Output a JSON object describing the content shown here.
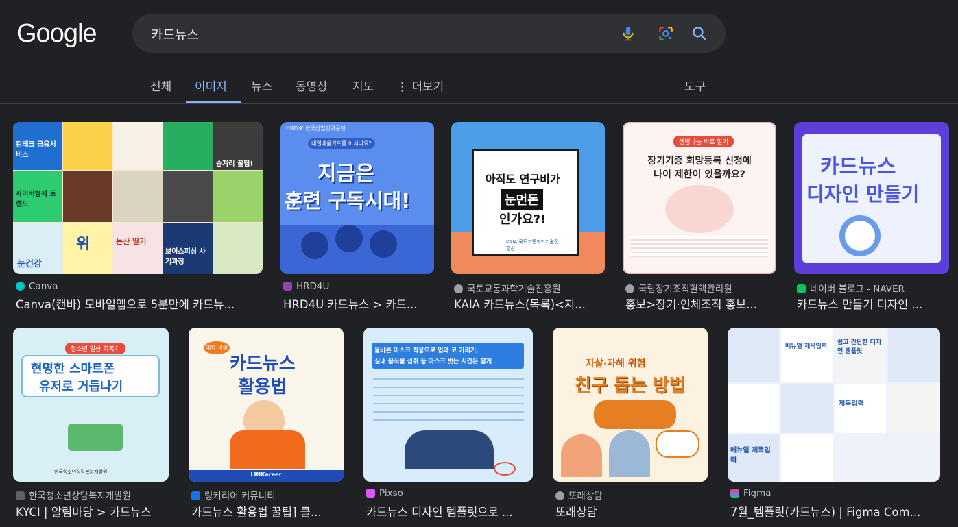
{
  "logo": "Google",
  "search": {
    "query": "카드뉴스"
  },
  "tabs": [
    {
      "label": "전체"
    },
    {
      "label": "이미지"
    },
    {
      "label": "뉴스"
    },
    {
      "label": "동영상"
    },
    {
      "label": "지도"
    },
    {
      "label": "더보기"
    }
  ],
  "tools_label": "도구",
  "results": [
    {
      "source": "Canva",
      "title": "Canva(캔바) 모바일앱으로 5분만에 카드뉴...",
      "favicon_color": "#00c4cc",
      "thumb_text": [
        "핀테크 금융서비스",
        "사이버범죄 트렌드",
        "위",
        "논산 딸기",
        "눈건강",
        "숨자리 꿀팁!",
        "보이스피싱 사기과정"
      ]
    },
    {
      "source": "HRD4U",
      "title": "HRD4U 카드뉴스 > 카드...",
      "favicon_color": "#8e44ad",
      "thumb_text": [
        "HRD·K 한국산업인력공단",
        "내일배움카드를 아시나요?",
        "지금은",
        "훈련 구독시대!"
      ]
    },
    {
      "source": "국토교통과학기술진흥원",
      "title": "KAIA 카드뉴스(목록)<지...",
      "favicon_color": "#9aa0a6",
      "thumb_text": [
        "아직도 연구비가",
        "눈먼돈",
        "인가요?!",
        "KAIA 국토교통과학기술진흥원"
      ]
    },
    {
      "source": "국립장기조직혈액관리원",
      "title": "홍보>장기·인체조직 홍보...",
      "favicon_color": "#9aa0a6",
      "thumb_text": [
        "생명나눔 바로 알기",
        "장기기증 희망등록 신청에",
        "나이 제한이 있을까요?"
      ]
    },
    {
      "source": "네이버 블로그 - NAVER",
      "title": "카드뉴스 만들기 디자인 ...",
      "favicon_color": "#03c75a",
      "thumb_text": [
        "카드뉴스",
        "디자인 만들기"
      ]
    },
    {
      "source": "한국청소년상담복지개발원",
      "title": "KYCI | 알림마당 > 카드뉴스",
      "favicon_color": "#5f6368",
      "thumb_text": [
        "청소년 일상 회복기",
        "현명한 스마트폰",
        "유저로 거듭나기",
        "한국청소년상담복지개발원"
      ]
    },
    {
      "source": "링커리어 커뮤니티",
      "title": "카드뉴스 활용법 꿀팁] 클...",
      "favicon_color": "#1a73e8",
      "thumb_text": [
        "대학 생활",
        "카드뉴스",
        "활용법",
        "LINKareer"
      ]
    },
    {
      "source": "Pixso",
      "title": "카드뉴스 디자인 템플릿으로 ...",
      "favicon_color": "#e056fd",
      "thumb_text": [
        "올바른 마스크 착용으로 입과 코 가리기,",
        "실내 음식물 섭취 등 마스크 벗는 시간은 짧게"
      ]
    },
    {
      "source": "또래상담",
      "title": "또래상담",
      "favicon_color": "#9aa0a6",
      "thumb_text": [
        "자살·자해 위험",
        "친구 돕는 방법"
      ]
    },
    {
      "source": "Figma",
      "title": "7월_템플릿(카드뉴스) | Figma Com...",
      "favicon_color": "#f24e1e",
      "thumb_text": [
        "메뉴얼 제목입력",
        "쉽고 간단한 디자인 템플릿",
        "제목입력",
        "메뉴얼 제목입력"
      ]
    }
  ]
}
